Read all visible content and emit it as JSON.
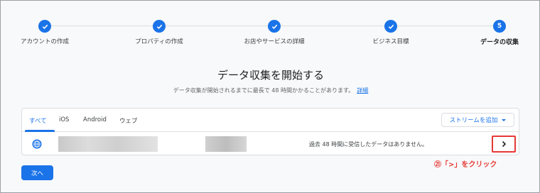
{
  "stepper": {
    "steps": [
      {
        "label": "アカウントの作成",
        "state": "done"
      },
      {
        "label": "プロパティの作成",
        "state": "done"
      },
      {
        "label": "お店やサービスの詳細",
        "state": "done"
      },
      {
        "label": "ビジネス目標",
        "state": "done"
      },
      {
        "label": "データの収集",
        "state": "active",
        "number": "5"
      }
    ]
  },
  "header": {
    "title": "データ収集を開始する",
    "subtitle": "データ収集が開始されるまでに最長で 48 時間かかることがあります。",
    "link": "詳細"
  },
  "tabs": [
    "すべて",
    "iOS",
    "Android",
    "ウェブ"
  ],
  "add_stream_label": "ストリームを追加",
  "stream_row": {
    "icon": "globe-icon",
    "status": "過去 48 時間に受信したデータはありません。"
  },
  "next_button": "次へ",
  "annotation": "㉑「>」をクリック",
  "colors": {
    "accent": "#1a73e8",
    "highlight": "#e53935"
  }
}
